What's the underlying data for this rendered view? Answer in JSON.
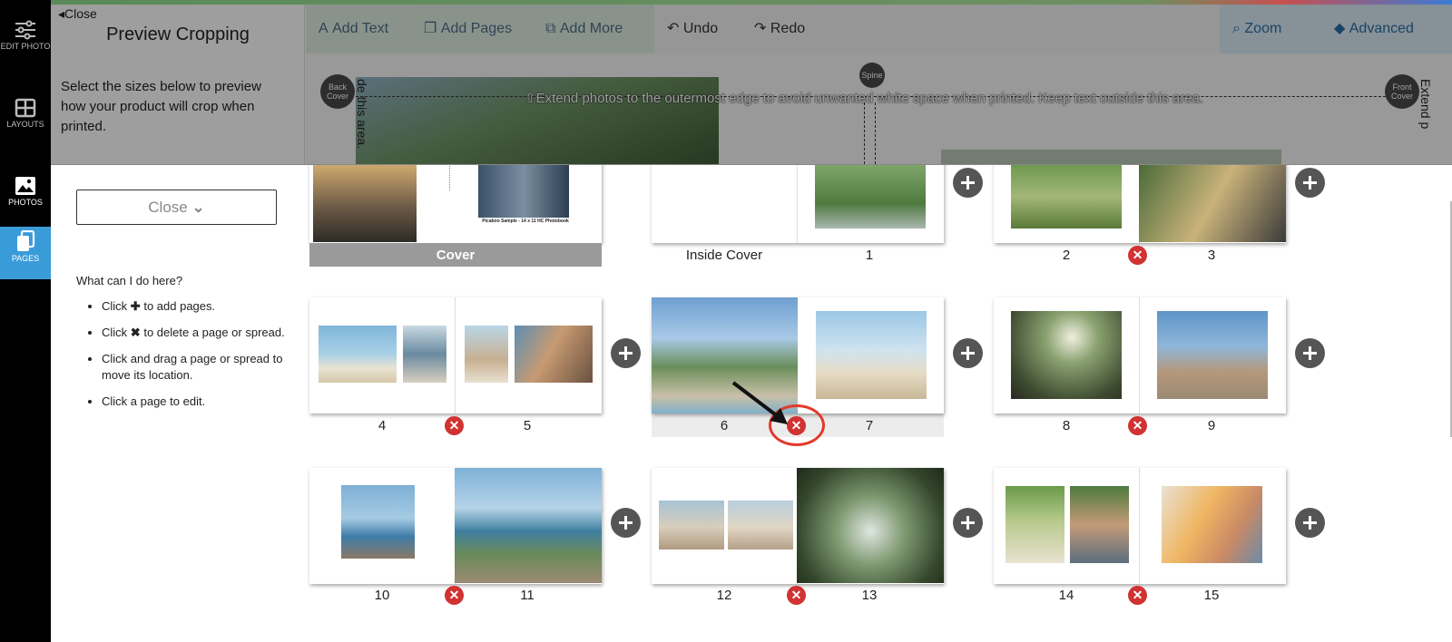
{
  "rail": [
    {
      "label": "EDIT PHOTO",
      "icon": "sliders-icon"
    },
    {
      "label": "LAYOUTS",
      "icon": "grid-icon"
    },
    {
      "label": "PHOTOS",
      "icon": "image-icon"
    },
    {
      "label": "PAGES",
      "icon": "pages-icon"
    }
  ],
  "editor": {
    "close_label": "Close",
    "title": "Preview Cropping",
    "description": "Select the sizes below to preview how your product will crop when printed.",
    "toolbar": {
      "add_text": "Add Text",
      "add_pages": "Add Pages",
      "add_more": "Add More",
      "undo": "Undo",
      "redo": "Redo",
      "zoom": "Zoom",
      "advanced": "Advanced"
    },
    "guide_text": "Extend photos to the outermost edge to avoid unwanted white space when printed. Keep text outside this area.",
    "back_cover_label": "Back Cover",
    "front_cover_label": "Front Cover",
    "spine_label": "Spine",
    "left_vertical_text": "de this area.",
    "right_vertical_text": "Extend p"
  },
  "pages_panel": {
    "close_label": "Close",
    "help_title": "What can I do here?",
    "help_items": [
      "to add pages.",
      "to delete a page or spread.",
      "Click and drag a page or spread to move its location.",
      "Click a page to edit."
    ],
    "help_click_word": "Click",
    "cover_caption": "Picaboo Sample - 14 x 11 HC Photobook",
    "labels": {
      "cover": "Cover",
      "inside_cover": "Inside Cover",
      "p1": "1",
      "p2": "2",
      "p3": "3",
      "p4": "4",
      "p5": "5",
      "p6": "6",
      "p7": "7",
      "p8": "8",
      "p9": "9",
      "p10": "10",
      "p11": "11",
      "p12": "12",
      "p13": "13",
      "p14": "14",
      "p15": "15"
    }
  },
  "colors": {
    "accent": "#3a9bd9",
    "delete": "#d13232",
    "highlight": "#e23a2a",
    "plus": "#555555"
  }
}
